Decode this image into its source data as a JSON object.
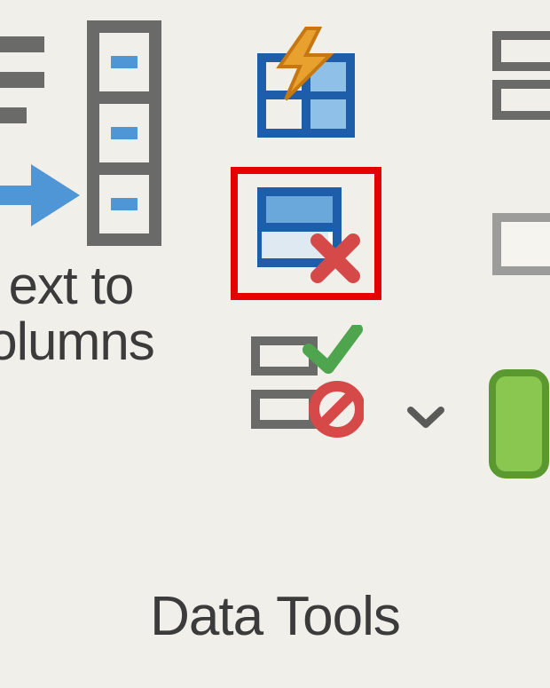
{
  "ribbon_group": {
    "label": "Data Tools",
    "text_to_columns": {
      "label_line1": "ext to",
      "label_line2": "olumns"
    },
    "buttons": {
      "flash_fill": "flash-fill",
      "remove_duplicates": "remove-duplicates",
      "data_validation": "data-validation",
      "consolidate": "consolidate",
      "relationships": "relationships",
      "data_model": "manage-data-model"
    },
    "highlight": "remove-duplicates"
  },
  "colors": {
    "highlight": "#e60000",
    "blue_fill": "#4f96d6",
    "blue_stroke": "#1e5daa",
    "orange": "#e8a02e",
    "green": "#4ea54e",
    "red": "#d64949",
    "gray_stroke": "#7a7a78"
  }
}
